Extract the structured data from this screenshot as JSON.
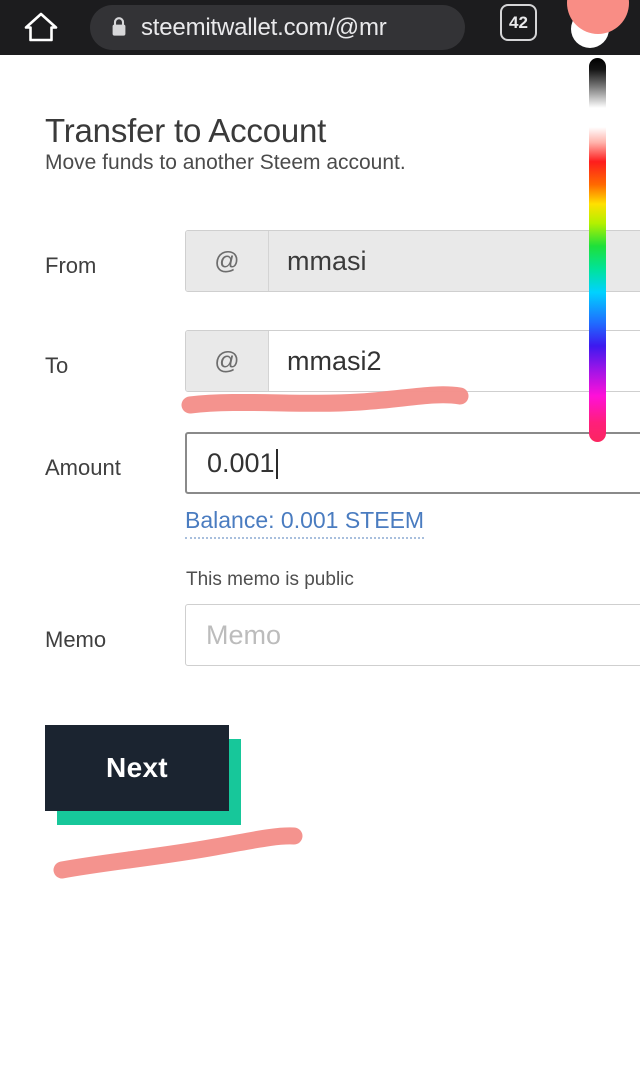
{
  "browser": {
    "home_icon": "home-icon",
    "lock_icon": "lock-icon",
    "url": "steemitwallet.com/@mr",
    "tab_count": "42",
    "avatar_icon": "avatar"
  },
  "page": {
    "title": "Transfer to Account",
    "subtitle": "Move funds to another Steem account."
  },
  "form": {
    "from": {
      "label": "From",
      "prefix": "@",
      "value": "mmasi",
      "disabled": true
    },
    "to": {
      "label": "To",
      "prefix": "@",
      "value": "mmasi2",
      "disabled": false
    },
    "amount": {
      "label": "Amount",
      "value": "0.001",
      "focused": true,
      "balance_link": "Balance: 0.001 STEEM"
    },
    "memo": {
      "label": "Memo",
      "hint": "This memo is public",
      "placeholder": "Memo",
      "value": ""
    }
  },
  "actions": {
    "next_label": "Next"
  },
  "annotations": {
    "stroke_color": "#f4908a",
    "strokes": [
      {
        "name": "underline-to-field",
        "desc": "curved stroke under To field"
      },
      {
        "name": "underline-next-button",
        "desc": "curved stroke under Next button"
      }
    ]
  },
  "color_picker": {
    "name": "color-gradient-slider",
    "selected_color": "#f98d85",
    "orientation": "vertical"
  },
  "theme": {
    "accent_teal": "#17c79a",
    "button_dark": "#1b2430",
    "link_blue": "#4a7cc0",
    "chrome_dark": "#1c1c1e"
  }
}
